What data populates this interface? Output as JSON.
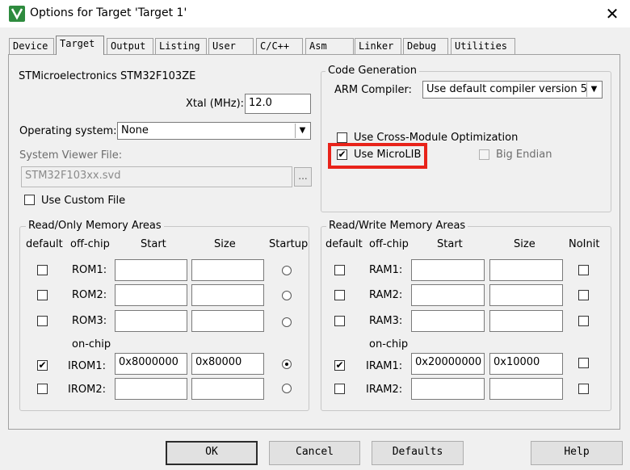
{
  "window": {
    "title": "Options for Target 'Target 1'",
    "close_icon": "✕"
  },
  "tabs": [
    "Device",
    "Target",
    "Output",
    "Listing",
    "User",
    "C/C++",
    "Asm",
    "Linker",
    "Debug",
    "Utilities"
  ],
  "active_tab": "Target",
  "device": {
    "name": "STMicroelectronics STM32F103ZE",
    "xtal_label": "Xtal (MHz):",
    "xtal_value": "12.0",
    "os_label": "Operating system:",
    "os_value": "None",
    "svd_label": "System Viewer File:",
    "svd_value": "STM32F103xx.svd",
    "browse_label": "...",
    "custom_file_label": "Use Custom File",
    "custom_file_checked": false
  },
  "code_generation": {
    "title": "Code Generation",
    "compiler_label": "ARM Compiler:",
    "compiler_value": "Use default compiler version 5",
    "cross_module_label": "Use Cross-Module Optimization",
    "cross_module_checked": false,
    "microlib_label": "Use MicroLIB",
    "microlib_checked": true,
    "big_endian_label": "Big Endian",
    "big_endian_checked": false,
    "highlight_color": "#e8231a"
  },
  "rom_areas": {
    "title": "Read/Only Memory Areas",
    "headers": [
      "default",
      "off-chip",
      "Start",
      "Size",
      "Startup"
    ],
    "onchip_label": "on-chip",
    "rows": [
      {
        "name": "ROM1:",
        "default": false,
        "start": "",
        "size": "",
        "startup": false
      },
      {
        "name": "ROM2:",
        "default": false,
        "start": "",
        "size": "",
        "startup": false
      },
      {
        "name": "ROM3:",
        "default": false,
        "start": "",
        "size": "",
        "startup": false
      },
      {
        "name": "IROM1:",
        "default": true,
        "start": "0x8000000",
        "size": "0x80000",
        "startup": true
      },
      {
        "name": "IROM2:",
        "default": false,
        "start": "",
        "size": "",
        "startup": false
      }
    ]
  },
  "ram_areas": {
    "title": "Read/Write Memory Areas",
    "headers": [
      "default",
      "off-chip",
      "Start",
      "Size",
      "NoInit"
    ],
    "onchip_label": "on-chip",
    "rows": [
      {
        "name": "RAM1:",
        "default": false,
        "start": "",
        "size": "",
        "noinit": false
      },
      {
        "name": "RAM2:",
        "default": false,
        "start": "",
        "size": "",
        "noinit": false
      },
      {
        "name": "RAM3:",
        "default": false,
        "start": "",
        "size": "",
        "noinit": false
      },
      {
        "name": "IRAM1:",
        "default": true,
        "start": "0x20000000",
        "size": "0x10000",
        "noinit": false
      },
      {
        "name": "IRAM2:",
        "default": false,
        "start": "",
        "size": "",
        "noinit": false
      }
    ]
  },
  "buttons": {
    "ok": "OK",
    "cancel": "Cancel",
    "defaults": "Defaults",
    "help": "Help"
  }
}
